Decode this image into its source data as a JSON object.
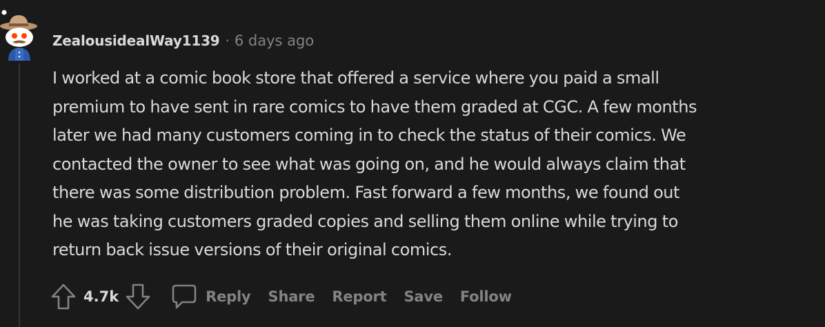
{
  "comment": {
    "author": "ZealousidealWay1139",
    "separator": "·",
    "timestamp": "6 days ago",
    "lines": [
      "I worked at a comic book store that offered a service where you paid a small",
      "premium to have sent in rare comics to have them graded at CGC. A few months",
      "later we had many customers coming in to check the status of their comics. We",
      "contacted the owner to see what was going on, and he would always claim that",
      "there was some distribution problem. Fast forward a few months, we found out",
      "he was taking customers graded copies and selling them online while trying to",
      "return back issue versions of their original comics."
    ]
  },
  "actions": {
    "score": "4.7k",
    "reply_label": "Reply",
    "share_label": "Share",
    "report_label": "Report",
    "save_label": "Save",
    "follow_label": "Follow"
  },
  "icons": {
    "upvote": "arrow-up-icon",
    "downvote": "arrow-down-icon",
    "reply": "speech-bubble-icon"
  },
  "colors": {
    "background": "#1a1a1b",
    "text": "#d7dadc",
    "muted": "#818384",
    "thread_line": "#343536"
  }
}
